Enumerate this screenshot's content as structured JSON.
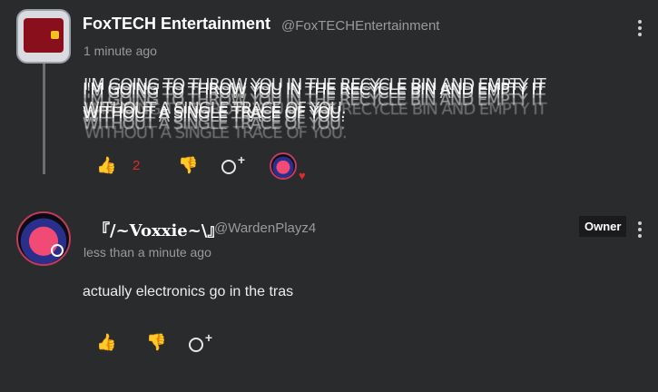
{
  "comments": [
    {
      "author": "FoxTECH Entertainment",
      "handle": "@FoxTECHEntertainment",
      "time": "1 minute ago",
      "text": "I'M GOING TO THROW YOU IN THE RECYCLE BIN AND EMPTY IT WITHOUT A SINGLE TRACE OF YOU.",
      "likes": "2",
      "icons": {
        "like": "thumbs-up-icon",
        "dislike": "thumbs-down-icon",
        "react": "add-reaction-icon",
        "menu": "kebab-menu-icon"
      }
    },
    {
      "author": "『/~Voxxie~\\』",
      "handle": "@WardenPlayz4",
      "time": "less than a minute ago",
      "badge": "Owner",
      "text": "actually electronics go in the tras",
      "icons": {
        "like": "thumbs-up-icon",
        "dislike": "thumbs-down-icon",
        "react": "add-reaction-icon",
        "menu": "kebab-menu-icon"
      }
    }
  ],
  "colors": {
    "accent": "#e02a2a",
    "background": "#2a2b2d",
    "muted": "#9a9a9a"
  }
}
